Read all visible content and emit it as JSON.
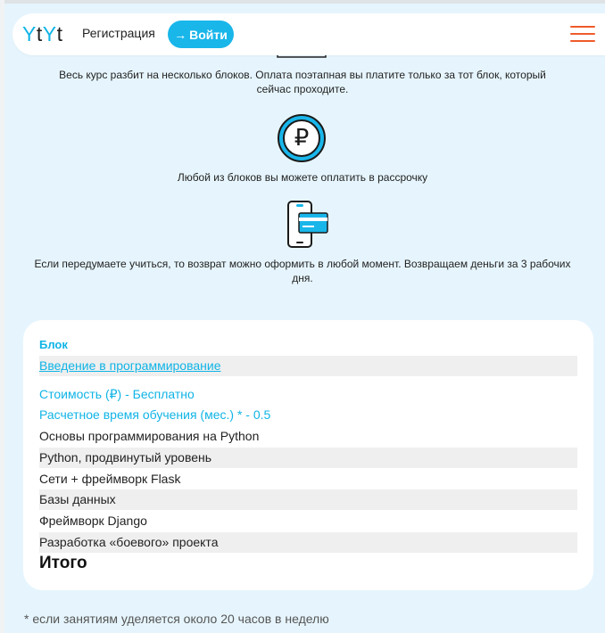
{
  "header": {
    "logo": [
      "Y",
      "t",
      "Y",
      "t"
    ],
    "register_label": "Регистрация",
    "login_label": "Войти",
    "login_arrow": "→"
  },
  "info": {
    "blocks_text_line1": "Весь курс разбит на несколько блоков. Оплата поэтапная вы платите только за тот блок, который",
    "blocks_text_line2": "сейчас проходите.",
    "installment_text": "Любой из блоков вы можете оплатить в рассрочку",
    "refund_text_line1": "Если передумаете учиться, то возврат можно оформить в любой момент. Возвращаем деньги за 3 рабочих",
    "refund_text_line2": "дня.",
    "ruble_symbol": "₽"
  },
  "card": {
    "title": "Блок",
    "intro_link": "Введение в программирование",
    "cost": "Стоимость (₽) - Бесплатно",
    "duration": "Расчетное время обучения (мес.) * - 0.5",
    "modules": [
      "Основы программирования на Python",
      "Python, продвинутый уровень",
      "Сети + фреймворк Flask",
      "Базы данных",
      "Фреймворк Django",
      "Разработка «боевого» проекта"
    ],
    "total_label": "Итого"
  },
  "footnote": "* если занятиям уделяется около 20 часов в неделю",
  "colors": {
    "accent": "#19b6ea",
    "menu": "#ef5a2a",
    "background": "#e6f5fd"
  },
  "icons": [
    "ruble-coin-icon",
    "phone-card-icon",
    "menu-icon",
    "arrow-right-icon"
  ]
}
